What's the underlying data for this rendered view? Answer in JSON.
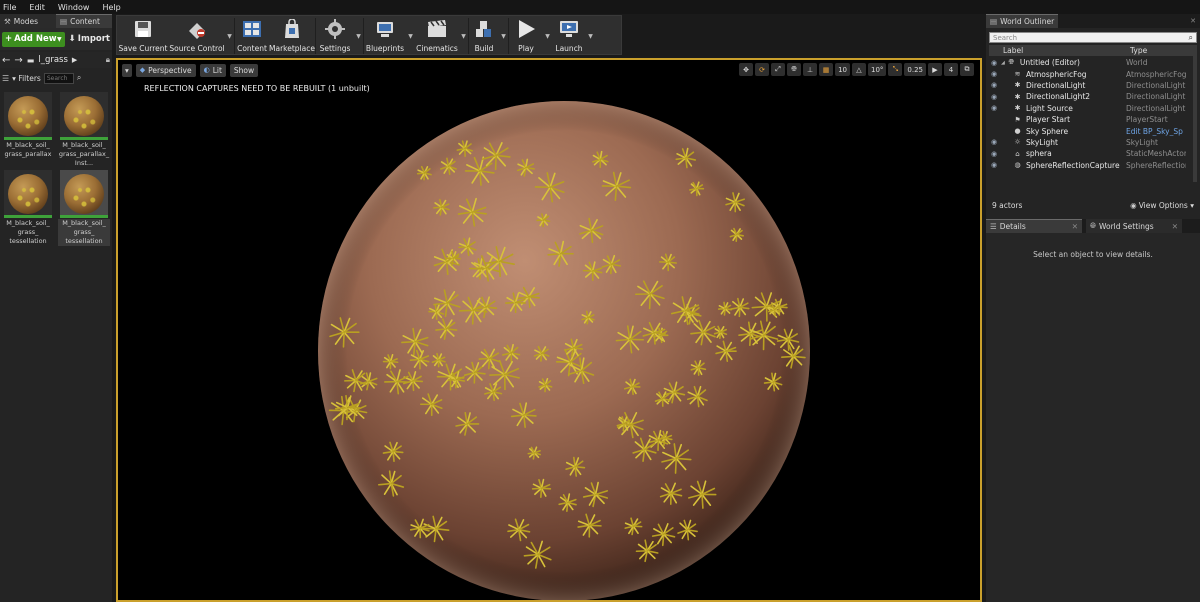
{
  "menu": [
    "File",
    "Edit",
    "Window",
    "Help"
  ],
  "left_panel": {
    "tab_modes": "Modes",
    "tab_content": "Content",
    "add_new": "Add New",
    "import": "Import",
    "path": "l_grass",
    "filters": "Filters",
    "search_placeholder": "Search",
    "assets": [
      {
        "label": "M_black_soil_\ngrass_parallax"
      },
      {
        "label": "M_black_soil_\ngrass_parallax_\nInst..."
      },
      {
        "label": "M_black_soil_\ngrass_\ntessellation"
      },
      {
        "label": "M_black_soil_\ngrass_\ntessellation"
      }
    ]
  },
  "toolbar": [
    {
      "label": "Save Current",
      "icon": "save-icon"
    },
    {
      "label": "Source Control",
      "icon": "source-control-icon"
    },
    {
      "label": "Content",
      "icon": "content-browser-icon"
    },
    {
      "label": "Marketplace",
      "icon": "marketplace-icon"
    },
    {
      "label": "Settings",
      "icon": "settings-icon"
    },
    {
      "label": "Blueprints",
      "icon": "blueprints-icon"
    },
    {
      "label": "Cinematics",
      "icon": "cinematics-icon"
    },
    {
      "label": "Build",
      "icon": "build-icon"
    },
    {
      "label": "Play",
      "icon": "play-icon"
    },
    {
      "label": "Launch",
      "icon": "launch-icon"
    }
  ],
  "viewport": {
    "perspective": "Perspective",
    "lit": "Lit",
    "show": "Show",
    "grid_snap": "10",
    "rotation_snap": "10°",
    "scale_snap": "0.25",
    "camera_speed": "4",
    "message": "REFLECTION CAPTURES NEED TO BE REBUILT (1 unbuilt)"
  },
  "world_outliner": {
    "tab": "World Outliner",
    "search_placeholder": "Search",
    "col_label": "Label",
    "col_type": "Type",
    "rows": [
      {
        "label": "Untitled (Editor)",
        "type": "World",
        "icon": "world-icon",
        "level": 0
      },
      {
        "label": "AtmosphericFog",
        "type": "AtmosphericFog",
        "icon": "fog-icon",
        "level": 1
      },
      {
        "label": "DirectionalLight",
        "type": "DirectionalLight",
        "icon": "light-icon",
        "level": 1
      },
      {
        "label": "DirectionalLight2",
        "type": "DirectionalLight",
        "icon": "light-icon",
        "level": 1
      },
      {
        "label": "Light Source",
        "type": "DirectionalLight",
        "icon": "light-icon",
        "level": 1
      },
      {
        "label": "Player Start",
        "type": "PlayerStart",
        "icon": "player-start-icon",
        "level": 1
      },
      {
        "label": "Sky Sphere",
        "type": "Edit BP_Sky_Sp",
        "icon": "sky-sphere-icon",
        "level": 1,
        "link": true
      },
      {
        "label": "SkyLight",
        "type": "SkyLight",
        "icon": "skylight-icon",
        "level": 1
      },
      {
        "label": "sphera",
        "type": "StaticMeshActor",
        "icon": "mesh-icon",
        "level": 1
      },
      {
        "label": "SphereReflectionCapture",
        "type": "SphereReflection",
        "icon": "reflection-icon",
        "level": 1
      }
    ],
    "actor_count": "9 actors",
    "view_options": "View Options"
  },
  "details": {
    "tab_details": "Details",
    "tab_world_settings": "World Settings",
    "empty_message": "Select an object to view details."
  },
  "colors": {
    "viewport_border": "#caa02c",
    "add_new_green": "#3d8f1f",
    "link_blue": "#6fa5e6"
  }
}
